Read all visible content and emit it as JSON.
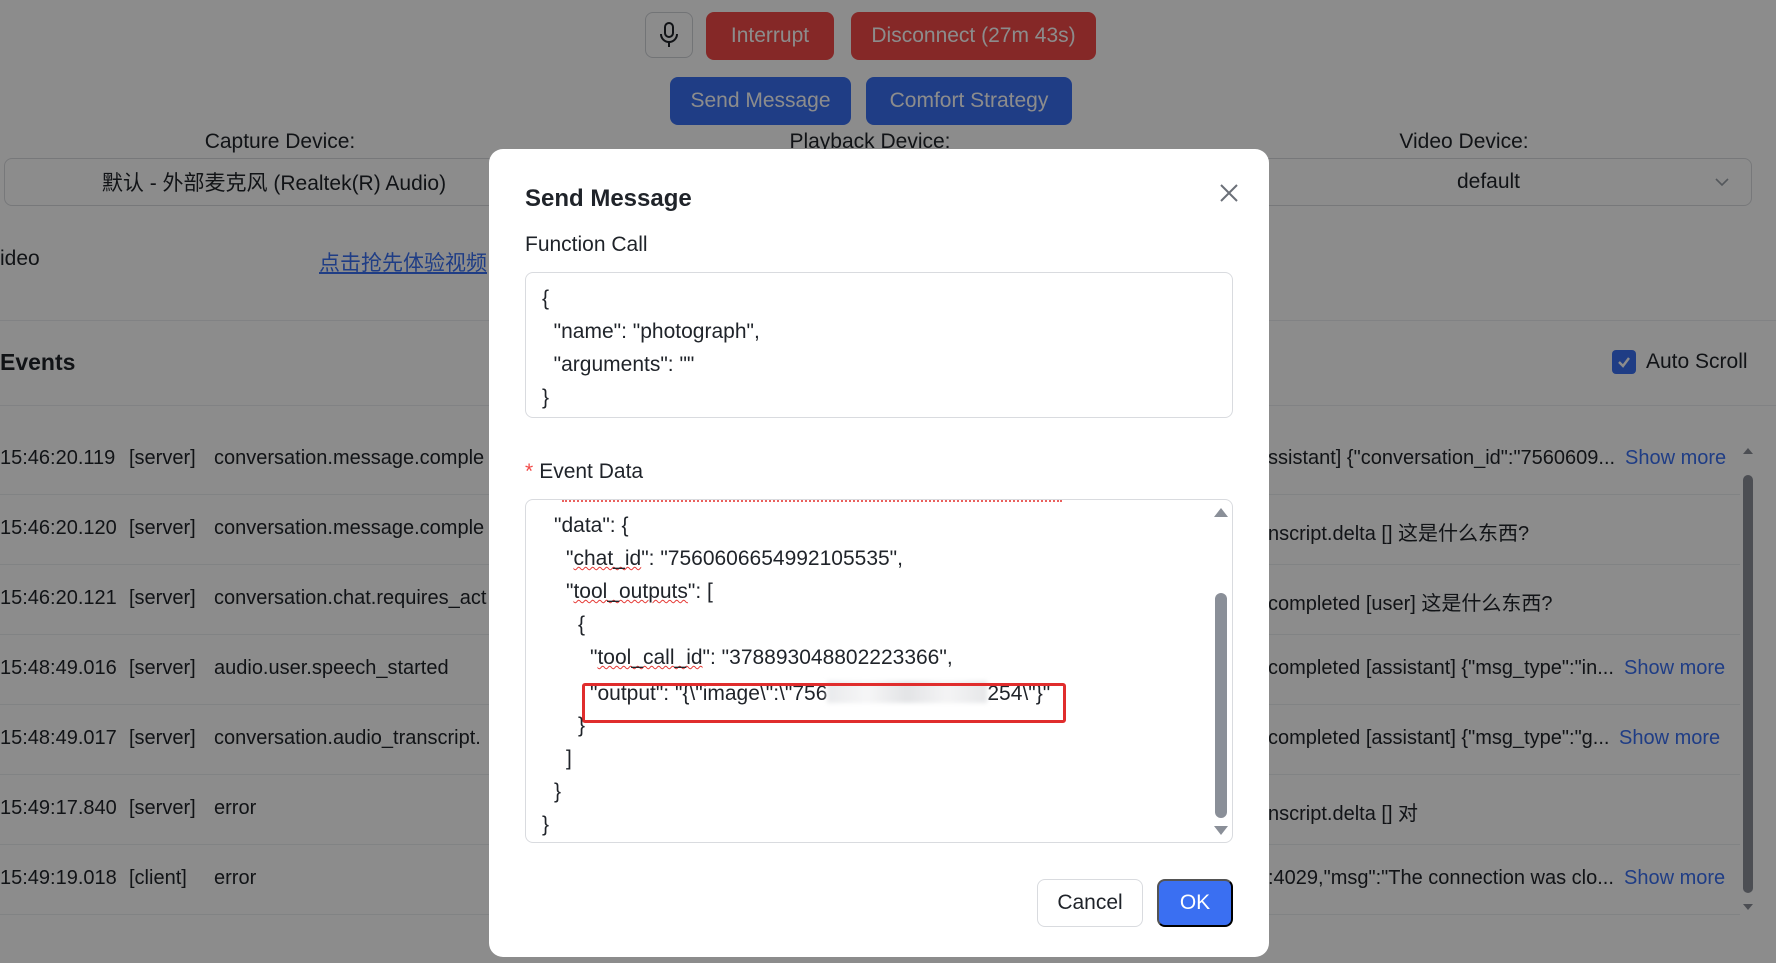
{
  "toolbar": {
    "interrupt_label": "Interrupt",
    "disconnect_label": "Disconnect (27m 43s)",
    "send_message_label": "Send Message",
    "comfort_strategy_label": "Comfort Strategy"
  },
  "devices": {
    "capture_label": "Capture Device:",
    "capture_value": "默认 - 外部麦克风 (Realtek(R) Audio)",
    "playback_label": "Playback Device:",
    "video_label": "Video Device:",
    "video_value": "default"
  },
  "video_row": {
    "label": "ideo",
    "link": "点击抢先体验视频"
  },
  "events": {
    "title": "Events",
    "auto_scroll_label": "Auto Scroll",
    "auto_scroll_checked": true,
    "show_more_label": "Show more",
    "rows": [
      {
        "time": "15:46:20.119",
        "source": "[server]",
        "type": "conversation.message.comple",
        "detail": "ssistant] {\"conversation_id\":\"7560609...",
        "show_more": true
      },
      {
        "time": "15:46:20.120",
        "source": "[server]",
        "type": "conversation.message.comple",
        "detail": "nscript.delta [] 这是什么东西?",
        "show_more": false
      },
      {
        "time": "15:46:20.121",
        "source": "[server]",
        "type": "conversation.chat.requires_act",
        "detail": "completed [user] 这是什么东西?",
        "show_more": false
      },
      {
        "time": "15:48:49.016",
        "source": "[server]",
        "type": "audio.user.speech_started",
        "detail": "completed [assistant] {\"msg_type\":\"in...",
        "show_more": true
      },
      {
        "time": "15:48:49.017",
        "source": "[server]",
        "type": "conversation.audio_transcript.",
        "detail": "completed [assistant] {\"msg_type\":\"g...",
        "show_more": true
      },
      {
        "time": "15:49:17.840",
        "source": "[server]",
        "type": "error",
        "detail": "nscript.delta [] 对",
        "show_more": false
      },
      {
        "time": "15:49:19.018",
        "source": "[client]",
        "type": "error",
        "detail": ":4029,\"msg\":\"The connection was clo...",
        "show_more": true
      }
    ]
  },
  "modal": {
    "title": "Send Message",
    "function_call_label": "Function Call",
    "function_call_lines": [
      "{",
      "  \"name\": \"photograph\",",
      "  \"arguments\": \"\"",
      "}"
    ],
    "event_data_required_mark": "*",
    "event_data_label": "Event Data",
    "event_data": {
      "line_data": "\"data\": {",
      "chat_id_key": "chat_id",
      "chat_id_value": ": \"7560606654992105535\",",
      "tool_outputs_key": "tool_outputs",
      "tool_outputs_rest": ": [",
      "open_brace": "{",
      "tool_call_id_key": "tool_call_id",
      "tool_call_id_value": ": \"378893048802223366\",",
      "output_prefix": "\"output\": \"{\\\"image\\\":\\\"756",
      "output_suffix": "254\\\"}\"",
      "close_brace": "}",
      "close_bracket": "]",
      "close_data": "}",
      "close_root": "}"
    },
    "cancel_label": "Cancel",
    "ok_label": "OK"
  },
  "colors": {
    "primary": "#3a6ff2",
    "danger": "#f24a48",
    "highlight_box": "#e02d2d"
  }
}
